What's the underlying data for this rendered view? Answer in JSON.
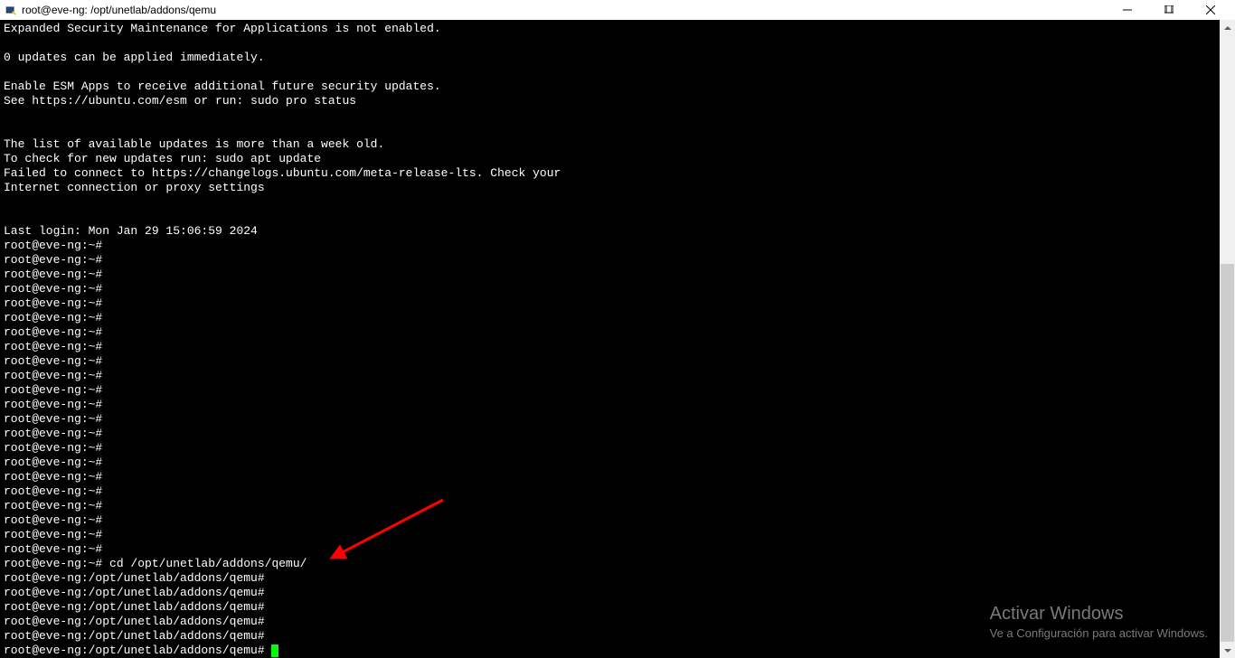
{
  "window": {
    "title": "root@eve-ng: /opt/unetlab/addons/qemu"
  },
  "terminal": {
    "lines": [
      "Expanded Security Maintenance for Applications is not enabled.",
      "",
      "0 updates can be applied immediately.",
      "",
      "Enable ESM Apps to receive additional future security updates.",
      "See https://ubuntu.com/esm or run: sudo pro status",
      "",
      "",
      "The list of available updates is more than a week old.",
      "To check for new updates run: sudo apt update",
      "Failed to connect to https://changelogs.ubuntu.com/meta-release-lts. Check your",
      "Internet connection or proxy settings",
      "",
      "",
      "Last login: Mon Jan 29 15:06:59 2024",
      "root@eve-ng:~#",
      "root@eve-ng:~#",
      "root@eve-ng:~#",
      "root@eve-ng:~#",
      "root@eve-ng:~#",
      "root@eve-ng:~#",
      "root@eve-ng:~#",
      "root@eve-ng:~#",
      "root@eve-ng:~#",
      "root@eve-ng:~#",
      "root@eve-ng:~#",
      "root@eve-ng:~#",
      "root@eve-ng:~#",
      "root@eve-ng:~#",
      "root@eve-ng:~#",
      "root@eve-ng:~#",
      "root@eve-ng:~#",
      "root@eve-ng:~#",
      "root@eve-ng:~#",
      "root@eve-ng:~#",
      "root@eve-ng:~#",
      "root@eve-ng:~#",
      "root@eve-ng:~# cd /opt/unetlab/addons/qemu/",
      "root@eve-ng:/opt/unetlab/addons/qemu#",
      "root@eve-ng:/opt/unetlab/addons/qemu#",
      "root@eve-ng:/opt/unetlab/addons/qemu#",
      "root@eve-ng:/opt/unetlab/addons/qemu#",
      "root@eve-ng:/opt/unetlab/addons/qemu#"
    ],
    "current_prompt": "root@eve-ng:/opt/unetlab/addons/qemu# "
  },
  "watermark": {
    "title": "Activar Windows",
    "subtitle": "Ve a Configuración para activar Windows."
  },
  "annotation": {
    "arrow_color": "#ff0000"
  }
}
